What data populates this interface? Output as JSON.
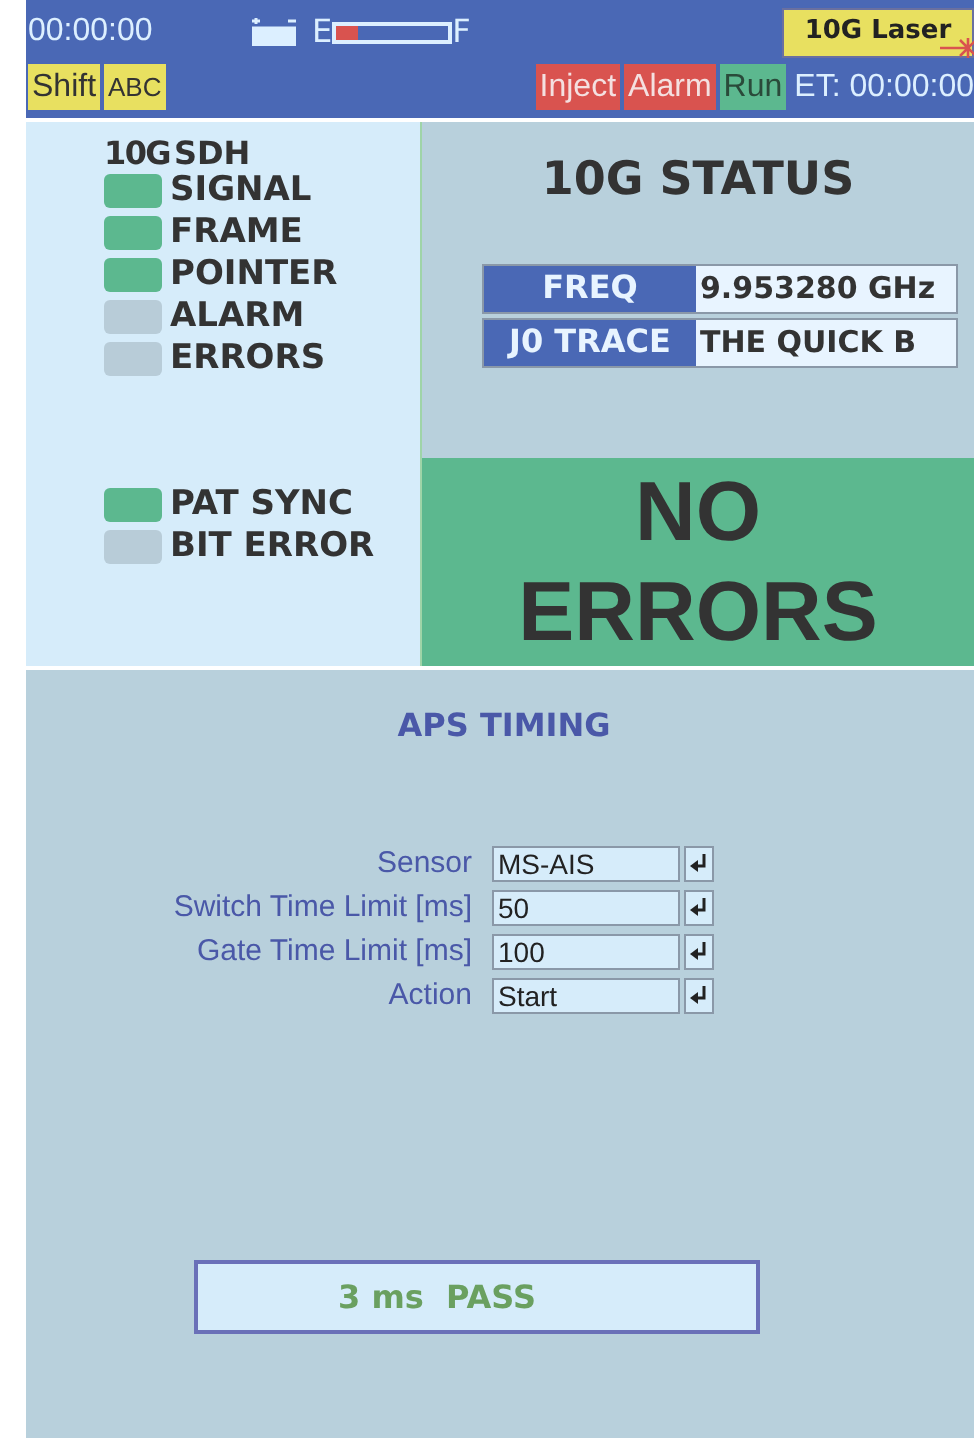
{
  "header": {
    "clock": "00:00:00",
    "gauge": {
      "empty_label": "E",
      "full_label": "F",
      "level": 0.2
    },
    "laser": {
      "label": "10G Laser",
      "on": true
    },
    "modes": [
      "Shift",
      "ABC"
    ],
    "indicators": [
      {
        "label": "Inject",
        "color": "#d9534f"
      },
      {
        "label": "Alarm",
        "color": "#d9534f"
      },
      {
        "label": "Run",
        "color": "#5cb88f"
      }
    ],
    "elapsed": "ET: 00:00:00"
  },
  "sdh": {
    "title_prefix": "10G",
    "title": "SDH",
    "leds": [
      {
        "label": "SIGNAL",
        "on": true
      },
      {
        "label": "FRAME",
        "on": true
      },
      {
        "label": "POINTER",
        "on": true
      },
      {
        "label": "ALARM",
        "on": false
      },
      {
        "label": "ERRORS",
        "on": false
      }
    ],
    "pattern_leds": [
      {
        "label": "PAT SYNC",
        "on": true
      },
      {
        "label": "BIT ERROR",
        "on": false
      }
    ]
  },
  "status": {
    "title": "10G STATUS",
    "fields": [
      {
        "label": "FREQ",
        "value": "9.953280 GHz"
      },
      {
        "label": "J0 TRACE",
        "value": "THE QUICK B"
      }
    ],
    "result": {
      "lines": [
        "NO",
        "ERRORS"
      ],
      "ok": true
    }
  },
  "aps": {
    "title": "APS TIMING",
    "params": [
      {
        "label": "Sensor",
        "value": "MS-AIS"
      },
      {
        "label": "Switch Time Limit [ms]",
        "value": "50"
      },
      {
        "label": "Gate Time Limit [ms]",
        "value": "100"
      },
      {
        "label": "Action",
        "value": "Start"
      }
    ],
    "result": "3 ms  PASS"
  }
}
